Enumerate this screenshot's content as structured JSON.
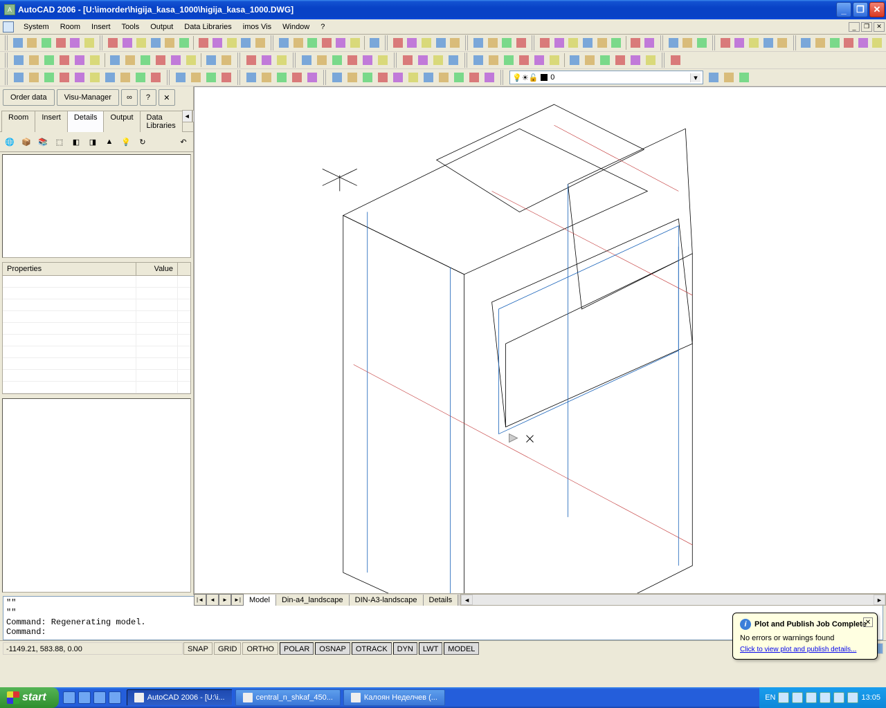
{
  "title_bar": {
    "app": "AutoCAD 2006",
    "doc": "[U:\\imorder\\higija_kasa_1000\\higija_kasa_1000.DWG]"
  },
  "menu": [
    "System",
    "Room",
    "Insert",
    "Tools",
    "Output",
    "Data Libraries",
    "imos Vis",
    "Window",
    "?"
  ],
  "side": {
    "order_btn": "Order data",
    "visu_btn": "Visu-Manager",
    "tabs": [
      "Room",
      "Insert",
      "Details",
      "Output",
      "Data Libraries"
    ],
    "active_tab": 2,
    "props_head": {
      "c1": "Properties",
      "c2": "Value"
    }
  },
  "layout_tabs": [
    "Model",
    "Din-a4_landscape",
    "DIN-A3-landscape",
    "Details"
  ],
  "layout_active": 0,
  "command_lines": [
    "\"\"",
    "\"\"",
    "Command: Regenerating model.",
    "Command:"
  ],
  "status": {
    "coords": "-1149.21, 583.88, 0.00",
    "btns": [
      "SNAP",
      "GRID",
      "ORTHO",
      "POLAR",
      "OSNAP",
      "OTRACK",
      "DYN",
      "LWT",
      "MODEL"
    ],
    "on": [
      "POLAR",
      "OSNAP",
      "OTRACK",
      "DYN",
      "LWT",
      "MODEL"
    ]
  },
  "layer_combo": {
    "bulb": "💡",
    "sun": "☀",
    "lock": "🔓",
    "name": "0"
  },
  "balloon": {
    "title": "Plot and Publish Job Complete",
    "msg": "No errors or warnings found",
    "link": "Click to view plot and publish details..."
  },
  "taskbar": {
    "start": "start",
    "tasks": [
      "AutoCAD 2006 - [U:\\i...",
      "central_n_shkaf_450...",
      "Калоян Неделчев (..."
    ],
    "active_task": 0,
    "lang": "EN",
    "clock": "13:05"
  }
}
